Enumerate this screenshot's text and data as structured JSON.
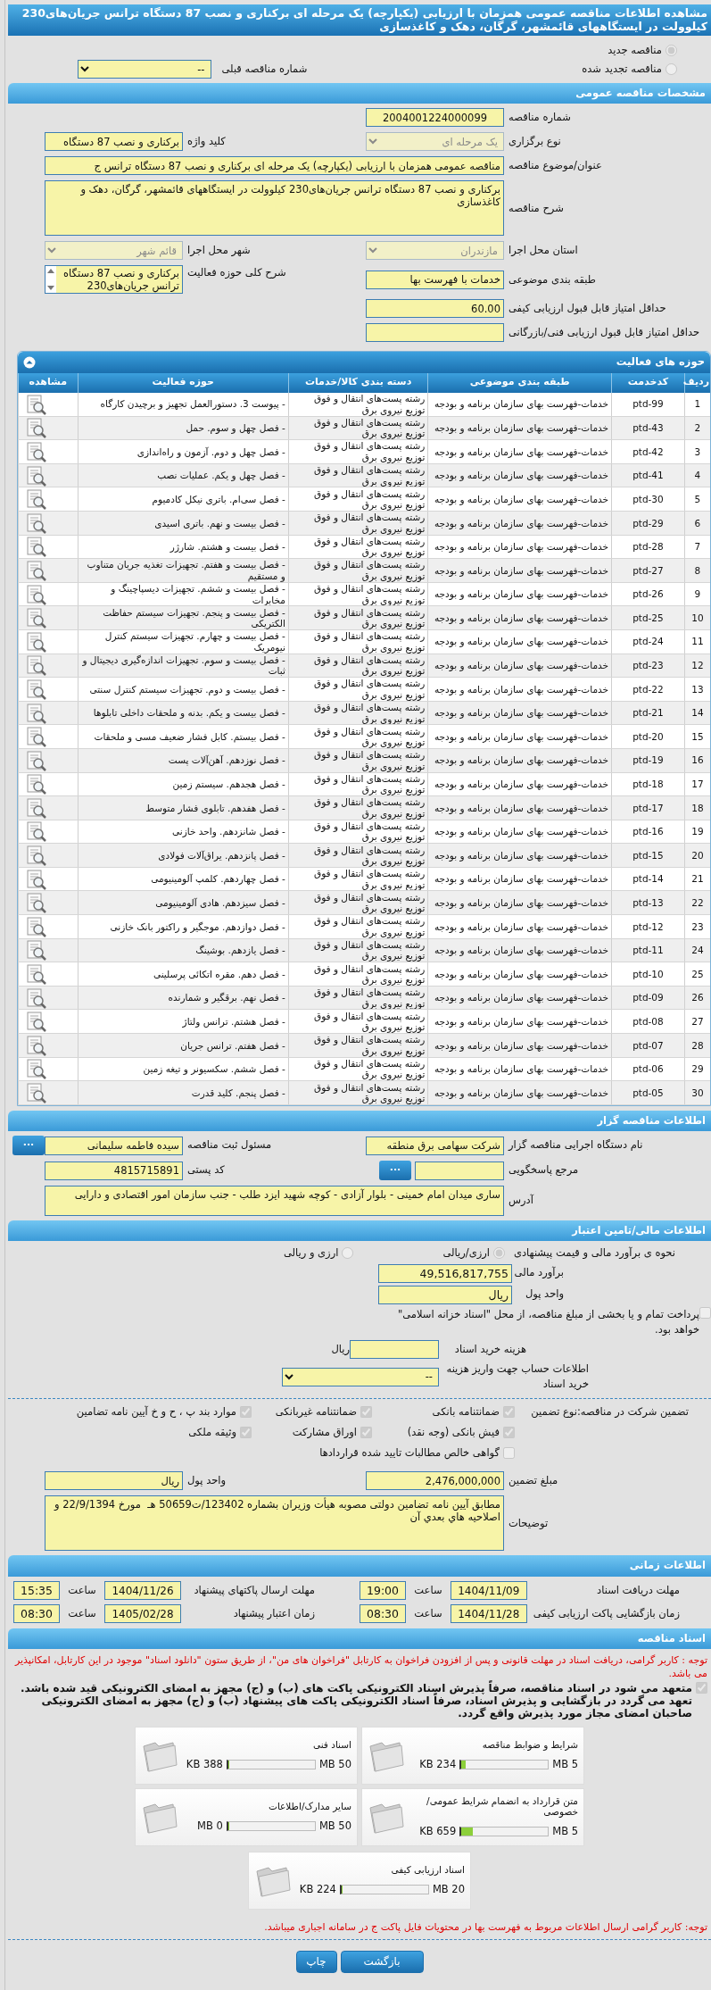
{
  "page_title": "مشاهده اطلاعات مناقصه عمومی همزمان با ارزیابی (یکپارچه) یک مرحله ای برکناری و نصب 87 دستگاه ترانس جریان‌های230 کیلوولت در ایستگاههای قائمشهر، گرگان، دهک و کاغذسازی",
  "tender_kind": [
    {
      "label": "مناقصه جدید",
      "selected": true
    },
    {
      "label": "مناقصه تجدید شده",
      "selected": false
    }
  ],
  "previous_tender": {
    "label": "شماره مناقصه قبلی",
    "value": "--",
    "disabled": false
  },
  "general": {
    "title": "مشخصات مناقصه عمومی",
    "tender_number": {
      "label": "شماره مناقصه",
      "value": "2004001224000099"
    },
    "holding_type": {
      "label": "نوع برگزاری",
      "value": "یک مرحله ای",
      "disabled": true
    },
    "keyword": {
      "label": "کلید واژه",
      "value": "برکناری و نصب 87 دستگاه"
    },
    "subject": {
      "label": "عنوان/موضوع مناقصه",
      "value": "مناقصه عمومی همزمان با ارزیابی (یکپارچه) یک مرحله ای برکناری و نصب 87 دستگاه ترانس ج"
    },
    "description": {
      "label": "شرح مناقصه",
      "value": "برکناری و نصب 87 دستگاه ترانس جریان‌های230 کیلوولت در ایستگاههای قائمشهر، گرگان، دهک و کاغذسازی"
    },
    "province": {
      "label": "استان محل اجرا",
      "value": "مازندران",
      "disabled": true
    },
    "city": {
      "label": "شهر محل اجرا",
      "value": "قائم شهر",
      "disabled": true
    },
    "category": {
      "label": "طبقه بندی موضوعی",
      "value": "خدمات با فهرست بها"
    },
    "activity_scope": {
      "label": "شرح کلی حوزه فعالیت",
      "value": "برکناری و نصب 87 دستگاه ترانس جریان‌های230"
    },
    "min_quality_score": {
      "label": "حداقل امتیاز قابل قبول ارزیابی کیفی",
      "value": "60.00"
    },
    "min_technical_score": {
      "label": "حداقل امتیاز قابل قبول ارزیابی فنی/بازرگانی"
    }
  },
  "activities": {
    "title": "حوزه های فعالیت",
    "columns": [
      "ردیف",
      "کدخدمت",
      "طبقه بندی موضوعی",
      "دسته بندی کالا/خدمات",
      "حوزه فعالیت",
      "مشاهده"
    ],
    "rows": [
      {
        "no": "1",
        "code": "ptd-99",
        "category": "خدمات-فهرست بهای سازمان برنامه و بودجه",
        "group": "رشته پست‌های انتقال و فوق توزیع نیروی برق",
        "activity": "- پیوست 3. دستورالعمل تجهیز و برچیدن کارگاه"
      },
      {
        "no": "2",
        "code": "ptd-43",
        "category": "خدمات-فهرست بهای سازمان برنامه و بودجه",
        "group": "رشته پست‌های انتقال و فوق توزیع نیروی برق",
        "activity": "- فصل چهل و سوم. حمل"
      },
      {
        "no": "3",
        "code": "ptd-42",
        "category": "خدمات-فهرست بهای سازمان برنامه و بودجه",
        "group": "رشته پست‌های انتقال و فوق توزیع نیروی برق",
        "activity": "- فصل چهل و دوم. آزمون و راه‌اندازی"
      },
      {
        "no": "4",
        "code": "ptd-41",
        "category": "خدمات-فهرست بهای سازمان برنامه و بودجه",
        "group": "رشته پست‌های انتقال و فوق توزیع نیروی برق",
        "activity": "- فصل چهل و یکم. عملیات نصب"
      },
      {
        "no": "5",
        "code": "ptd-30",
        "category": "خدمات-فهرست بهای سازمان برنامه و بودجه",
        "group": "رشته پست‌های انتقال و فوق توزیع نیروی برق",
        "activity": "- فصل سی‌ام. باتری نیکل کادمیوم"
      },
      {
        "no": "6",
        "code": "ptd-29",
        "category": "خدمات-فهرست بهای سازمان برنامه و بودجه",
        "group": "رشته پست‌های انتقال و فوق توزیع نیروی برق",
        "activity": "- فصل بیست و نهم. باتری اسیدی"
      },
      {
        "no": "7",
        "code": "ptd-28",
        "category": "خدمات-فهرست بهای سازمان برنامه و بودجه",
        "group": "رشته پست‌های انتقال و فوق توزیع نیروی برق",
        "activity": "- فصل بیست و هشتم. شارژر"
      },
      {
        "no": "8",
        "code": "ptd-27",
        "category": "خدمات-فهرست بهای سازمان برنامه و بودجه",
        "group": "رشته پست‌های انتقال و فوق توزیع نیروی برق",
        "activity": "- فصل بیست و هفتم. تجهیزات تغذیه جریان متناوب و مستقیم"
      },
      {
        "no": "9",
        "code": "ptd-26",
        "category": "خدمات-فهرست بهای سازمان برنامه و بودجه",
        "group": "رشته پست‌های انتقال و فوق توزیع نیروی برق",
        "activity": "- فصل بیست و ششم. تجهیزات دیسپاچینگ و مخابرات"
      },
      {
        "no": "10",
        "code": "ptd-25",
        "category": "خدمات-فهرست بهای سازمان برنامه و بودجه",
        "group": "رشته پست‌های انتقال و فوق توزیع نیروی برق",
        "activity": "- فصل بیست و پنجم. تجهیزات سیستم حفاظت الکتریکی"
      },
      {
        "no": "11",
        "code": "ptd-24",
        "category": "خدمات-فهرست بهای سازمان برنامه و بودجه",
        "group": "رشته پست‌های انتقال و فوق توزیع نیروی برق",
        "activity": "- فصل بیست و چهارم. تجهیزات سیستم کنترل نیومریک"
      },
      {
        "no": "12",
        "code": "ptd-23",
        "category": "خدمات-فهرست بهای سازمان برنامه و بودجه",
        "group": "رشته پست‌های انتقال و فوق توزیع نیروی برق",
        "activity": "- فصل بیست و سوم. تجهیزات اندازه‌گیری دیجیتال و ثبات"
      },
      {
        "no": "13",
        "code": "ptd-22",
        "category": "خدمات-فهرست بهای سازمان برنامه و بودجه",
        "group": "رشته پست‌های انتقال و فوق توزیع نیروی برق",
        "activity": "- فصل بیست و دوم. تجهیزات سیستم کنترل سنتی"
      },
      {
        "no": "14",
        "code": "ptd-21",
        "category": "خدمات-فهرست بهای سازمان برنامه و بودجه",
        "group": "رشته پست‌های انتقال و فوق توزیع نیروی برق",
        "activity": "- فصل بیست و یکم. بدنه و ملحقات داخلی تابلوها"
      },
      {
        "no": "15",
        "code": "ptd-20",
        "category": "خدمات-فهرست بهای سازمان برنامه و بودجه",
        "group": "رشته پست‌های انتقال و فوق توزیع نیروی برق",
        "activity": "- فصل بیستم. کابل فشار ضعیف مسی و ملحقات"
      },
      {
        "no": "16",
        "code": "ptd-19",
        "category": "خدمات-فهرست بهای سازمان برنامه و بودجه",
        "group": "رشته پست‌های انتقال و فوق توزیع نیروی برق",
        "activity": "- فصل نوزدهم. آهن‌آلات پست"
      },
      {
        "no": "17",
        "code": "ptd-18",
        "category": "خدمات-فهرست بهای سازمان برنامه و بودجه",
        "group": "رشته پست‌های انتقال و فوق توزیع نیروی برق",
        "activity": "- فصل هجدهم. سیستم زمین"
      },
      {
        "no": "18",
        "code": "ptd-17",
        "category": "خدمات-فهرست بهای سازمان برنامه و بودجه",
        "group": "رشته پست‌های انتقال و فوق توزیع نیروی برق",
        "activity": "- فصل هفدهم. تابلوی فشار متوسط"
      },
      {
        "no": "19",
        "code": "ptd-16",
        "category": "خدمات-فهرست بهای سازمان برنامه و بودجه",
        "group": "رشته پست‌های انتقال و فوق توزیع نیروی برق",
        "activity": "- فصل شانزدهم. واحد خازنی"
      },
      {
        "no": "20",
        "code": "ptd-15",
        "category": "خدمات-فهرست بهای سازمان برنامه و بودجه",
        "group": "رشته پست‌های انتقال و فوق توزیع نیروی برق",
        "activity": "- فصل پانزدهم. یراق‌آلات فولادی"
      },
      {
        "no": "21",
        "code": "ptd-14",
        "category": "خدمات-فهرست بهای سازمان برنامه و بودجه",
        "group": "رشته پست‌های انتقال و فوق توزیع نیروی برق",
        "activity": "- فصل چهاردهم. کلمپ آلومینیومی"
      },
      {
        "no": "22",
        "code": "ptd-13",
        "category": "خدمات-فهرست بهای سازمان برنامه و بودجه",
        "group": "رشته پست‌های انتقال و فوق توزیع نیروی برق",
        "activity": "- فصل سیزدهم. هادی آلومینیومی"
      },
      {
        "no": "23",
        "code": "ptd-12",
        "category": "خدمات-فهرست بهای سازمان برنامه و بودجه",
        "group": "رشته پست‌های انتقال و فوق توزیع نیروی برق",
        "activity": "- فصل دوازدهم. موجگیر و راکتور بانک خازنی"
      },
      {
        "no": "24",
        "code": "ptd-11",
        "category": "خدمات-فهرست بهای سازمان برنامه و بودجه",
        "group": "رشته پست‌های انتقال و فوق توزیع نیروی برق",
        "activity": "- فصل یازدهم. بوشینگ"
      },
      {
        "no": "25",
        "code": "ptd-10",
        "category": "خدمات-فهرست بهای سازمان برنامه و بودجه",
        "group": "رشته پست‌های انتقال و فوق توزیع نیروی برق",
        "activity": "- فصل دهم. مقره اتکائی پرسلینی"
      },
      {
        "no": "26",
        "code": "ptd-09",
        "category": "خدمات-فهرست بهای سازمان برنامه و بودجه",
        "group": "رشته پست‌های انتقال و فوق توزیع نیروی برق",
        "activity": "- فصل نهم. برقگیر و شمارنده"
      },
      {
        "no": "27",
        "code": "ptd-08",
        "category": "خدمات-فهرست بهای سازمان برنامه و بودجه",
        "group": "رشته پست‌های انتقال و فوق توزیع نیروی برق",
        "activity": "- فصل هشتم. ترانس ولتاژ"
      },
      {
        "no": "28",
        "code": "ptd-07",
        "category": "خدمات-فهرست بهای سازمان برنامه و بودجه",
        "group": "رشته پست‌های انتقال و فوق توزیع نیروی برق",
        "activity": "- فصل هفتم. ترانس جریان"
      },
      {
        "no": "29",
        "code": "ptd-06",
        "category": "خدمات-فهرست بهای سازمان برنامه و بودجه",
        "group": "رشته پست‌های انتقال و فوق توزیع نیروی برق",
        "activity": "- فصل ششم. سکسیونر و تیغه زمین"
      },
      {
        "no": "30",
        "code": "ptd-05",
        "category": "خدمات-فهرست بهای سازمان برنامه و بودجه",
        "group": "رشته پست‌های انتقال و فوق توزیع نیروی برق",
        "activity": "- فصل پنجم. کلید قدرت"
      }
    ]
  },
  "organizer": {
    "title": "اطلاعات مناقصه گزار",
    "org_name": {
      "label": "نام دستگاه اجرایی مناقصه گزار",
      "value": "شرکت سهامی برق منطقه"
    },
    "registrar": {
      "label": "مسئول ثبت مناقصه",
      "value": "سیده فاطمه سلیمانی",
      "button": "..."
    },
    "response_ref": {
      "label": "مرجع پاسخگویی",
      "button": "..."
    },
    "postal_code": {
      "label": "کد پستی",
      "value": "4815715891"
    },
    "address": {
      "label": "آدرس",
      "value": "ساری میدان امام خمینی - بلوار آزادی - کوچه شهید ایزد طلب - جنب سازمان امور اقتصادی و دارایی"
    }
  },
  "financial": {
    "title": "اطلاعات مالی/تامین اعتبار",
    "estimate_mode": {
      "label": "نحوه ی برآورد مالی و قیمت پیشنهادی",
      "options": [
        {
          "label": "ارزی/ریالی",
          "selected": true
        },
        {
          "label": "ارزی و ریالی",
          "selected": false
        }
      ]
    },
    "estimate": {
      "label": "برآورد مالی",
      "value": "49,516,817,755"
    },
    "currency": {
      "label": "واحد پول",
      "value": "ریال"
    },
    "treasury": {
      "text": "پرداخت تمام و یا بخشی از مبلغ مناقصه، از محل \"اسناد خزانه اسلامی\" خواهد بود.",
      "checked": false
    },
    "doc_fee": {
      "label": "هزینه خرید اسناد",
      "unit": "ریال"
    },
    "account": {
      "label": "اطلاعات حساب جهت واریز هزینه خرید اسناد",
      "value": "--"
    },
    "guarantee": {
      "label": "تضمین شرکت در مناقصه:",
      "type_label": "نوع تضمین",
      "options": [
        {
          "label": "ضمانتنامه بانکی",
          "checked": true
        },
        {
          "label": "ضمانتنامه غیربانکی",
          "checked": true
        },
        {
          "label": "موارد بند پ ، ح و خ آیین نامه تضامین",
          "checked": true
        },
        {
          "label": "فیش بانکی (وجه نقد)",
          "checked": true
        },
        {
          "label": "اوراق مشارکت",
          "checked": true
        },
        {
          "label": "وثیقه ملکی",
          "checked": true
        },
        {
          "label": "گواهی خالص مطالبات تایید شده قراردادها",
          "checked": false
        }
      ]
    },
    "guarantee_amount": {
      "label": "مبلغ تضمین",
      "value": "2,476,000,000"
    },
    "guarantee_currency": {
      "label": "واحد پول",
      "value": "ریال"
    },
    "notes": {
      "label": "توضیحات",
      "value": "مطابق آیین نامه تضامین دولتی مصوبه هیأت وزیران بشماره 123402/ت50659 هـ  مورخ 22/9/1394 و اصلاحیه هاي بعدي آن"
    }
  },
  "timing": {
    "title": "اطلاعات زمانی",
    "items": [
      {
        "label": "مهلت دریافت اسناد",
        "date": "1404/11/09",
        "time_label": "ساعت",
        "time": "19:00"
      },
      {
        "label": "مهلت ارسال پاکتهای پیشنهاد",
        "date": "1404/11/26",
        "time_label": "ساعت",
        "time": "15:35"
      },
      {
        "label": "زمان بازگشایی پاکت ارزیابی کیفی",
        "date": "1404/11/28",
        "time_label": "ساعت",
        "time": "08:30"
      },
      {
        "label": "زمان اعتبار پیشنهاد",
        "date": "1405/02/28",
        "time_label": "ساعت",
        "time": "08:30"
      }
    ]
  },
  "documents": {
    "title": "اسناد مناقصه",
    "notice": "توجه : کاربر گرامی، دریافت اسناد در مهلت قانونی و پس از افزودن فراخوان به کارتابل \"فراخوان های من\"، از طریق ستون \"دانلود اسناد\" موجود در این کارتابل، امکانپذیر می باشد.",
    "commitment": {
      "text": "متعهد می شود در اسناد مناقصه، صرفاً پذیرش اسناد الکترونیکی پاکت های (ب) و (ج) مجهز به امضای الکترونیکی قید شده باشد. تعهد می گردد در بازگشایی و پذیرش اسناد، صرفاً اسناد الکترونیکی پاکت های پیشنهاد (ب) و (ج) مجهز به امضای الکترونیکی صاحبان امضای مجاز مورد پذیرش واقع گردد.",
      "checked": true
    },
    "files": [
      {
        "name": "شرایط و ضوابط مناقصه",
        "size": "234 KB",
        "max": "5 MB",
        "level": 0.05
      },
      {
        "name": "اسناد فنی",
        "size": "388 KB",
        "max": "50 MB",
        "level": 0.01
      },
      {
        "name": "متن قرارداد به انضمام شرایط عمومی/خصوصی",
        "size": "659 KB",
        "max": "5 MB",
        "level": 0.13
      },
      {
        "name": "سایر مدارک/اطلاعات",
        "size": "0 MB",
        "max": "50 MB",
        "level": 0
      },
      {
        "name": "اسناد ارزیابی کیفی",
        "size": "224 KB",
        "max": "20 MB",
        "level": 0.01
      }
    ],
    "footer_note": "توجه: کاربر گرامی ارسال اطلاعات مربوط به فهرست بها در محتویات فایل پاکت ج در سامانه اجباری میباشد."
  },
  "buttons": [
    "بازگشت",
    "چاپ"
  ]
}
